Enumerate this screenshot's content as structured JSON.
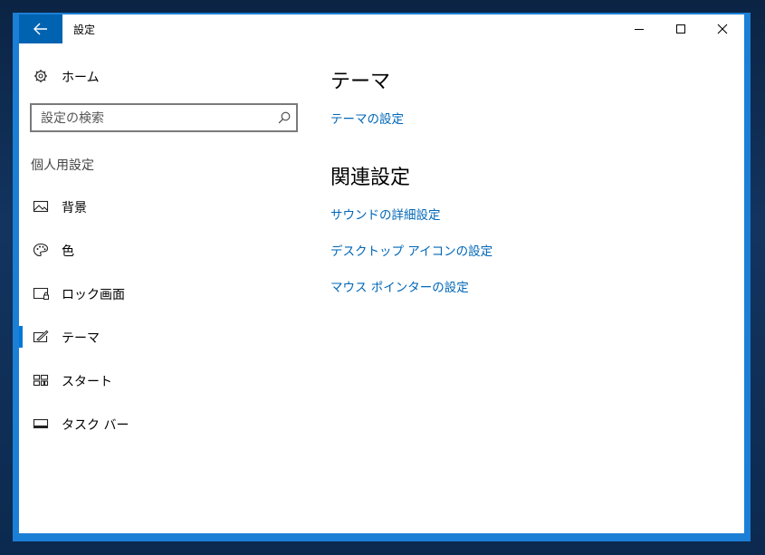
{
  "window": {
    "title": "設定"
  },
  "sidebar": {
    "home_label": "ホーム",
    "search_placeholder": "設定の検索",
    "section_label": "個人用設定",
    "items": [
      {
        "label": "背景",
        "icon": "picture-icon"
      },
      {
        "label": "色",
        "icon": "palette-icon"
      },
      {
        "label": "ロック画面",
        "icon": "lock-screen-icon"
      },
      {
        "label": "テーマ",
        "icon": "theme-brush-icon",
        "active": true
      },
      {
        "label": "スタート",
        "icon": "start-tiles-icon"
      },
      {
        "label": "タスク バー",
        "icon": "taskbar-icon"
      }
    ]
  },
  "main": {
    "title": "テーマ",
    "theme_settings_link": "テーマの設定",
    "related_heading": "関連設定",
    "related_links": [
      "サウンドの詳細設定",
      "デスクトップ アイコンの設定",
      "マウス ポインターの設定"
    ]
  },
  "colors": {
    "accent": "#0078d7",
    "link": "#0067b8",
    "back_button": "#0063b1",
    "frame": "#1c7fd6"
  }
}
